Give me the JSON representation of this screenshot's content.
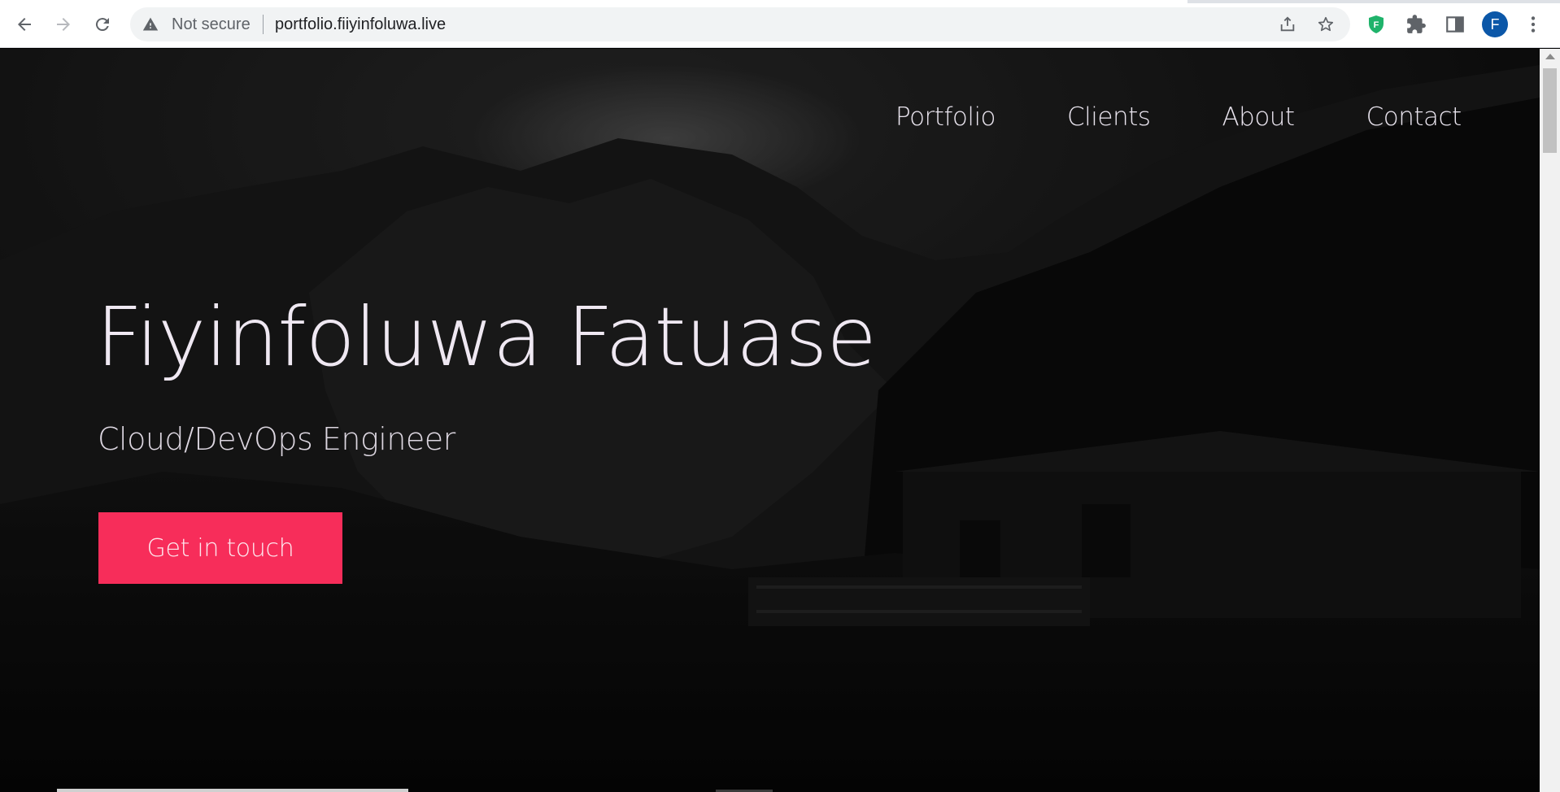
{
  "browser": {
    "security_text": "Not secure",
    "url": "portfolio.fiiyinfoluwa.live",
    "profile_initial": "F",
    "icons": [
      "back-arrow-icon",
      "forward-arrow-icon",
      "reload-icon",
      "warning-triangle-icon",
      "share-icon",
      "star-icon",
      "extension-shield-icon",
      "puzzle-icon",
      "side-panel-icon",
      "kebab-menu-icon"
    ],
    "accent_color": "#0b57a8"
  },
  "site": {
    "nav": [
      "Portfolio",
      "Clients",
      "About",
      "Contact"
    ],
    "name": "Fiyinfoluwa Fatuase",
    "role": "Cloud/DevOps Engineer",
    "cta_label": "Get in touch",
    "cta_color": "#f72d5a"
  }
}
